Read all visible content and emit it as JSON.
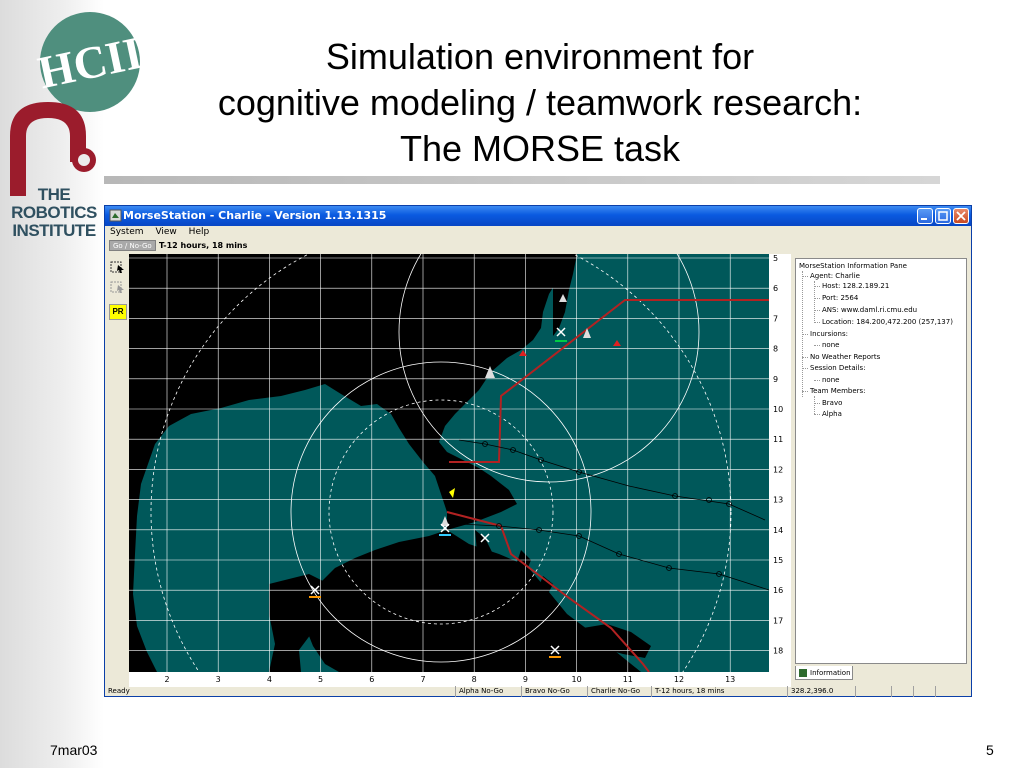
{
  "slide": {
    "title_lines": [
      "Simulation environment for",
      "cognitive modeling / teamwork research:",
      "The MORSE task"
    ],
    "footer_left": "7mar03",
    "footer_right": "5",
    "logo_top_text": "HCII",
    "logo_bottom_lines": [
      "THE",
      "ROBOTICS",
      "INSTITUTE"
    ]
  },
  "window": {
    "title": "MorseStation - Charlie - Version 1.13.1315",
    "menu": [
      "System",
      "View",
      "Help"
    ],
    "go_nogo_label": "Go / No-Go",
    "countdown": "T-12 hours, 18 mins",
    "toolbar_pr": "PR"
  },
  "map": {
    "x_ticks": [
      "2",
      "3",
      "4",
      "5",
      "6",
      "7",
      "8",
      "9",
      "10",
      "11",
      "12",
      "13"
    ],
    "y_ticks": [
      "5",
      "6",
      "7",
      "8",
      "9",
      "10",
      "11",
      "12",
      "13",
      "14",
      "15",
      "16",
      "17",
      "18"
    ],
    "colors": {
      "water": "#00585a",
      "land": "#000000",
      "grid": "#ffffff",
      "track": "#b22222"
    }
  },
  "info_pane": {
    "header": "MorseStation Information Pane",
    "agent": "Agent: Charlie",
    "host": "Host: 128.2.189.21",
    "port": "Port: 2564",
    "ans": "ANS: www.daml.ri.cmu.edu",
    "location": "Location: 184.200,472.200 (257,137)",
    "incursions": "Incursions:",
    "incursions_value": "none",
    "weather": "No Weather Reports",
    "session": "Session Details:",
    "session_value": "none",
    "team": "Team Members:",
    "team_members": [
      "Bravo",
      "Alpha"
    ],
    "tab_label": "Information"
  },
  "statusbar": {
    "ready": "Ready",
    "alpha": "Alpha No-Go",
    "bravo": "Bravo No-Go",
    "charlie": "Charlie No-Go",
    "time": "T-12 hours, 18 mins",
    "coords": "328.2,396.0"
  }
}
